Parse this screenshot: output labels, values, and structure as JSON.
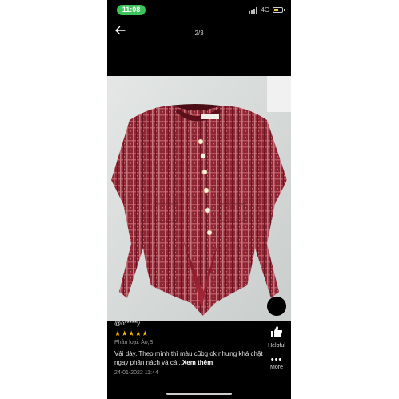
{
  "status_bar": {
    "time": "11:08",
    "network": "4G",
    "battery_level": 0.6
  },
  "viewer": {
    "page_counter": "2/3",
    "back_icon": "back-arrow-icon"
  },
  "review": {
    "reviewer": "@o*****y",
    "rating": 5,
    "stars": "★★★★★",
    "classification": "Phân loại: Áo,S",
    "text": "Vải dày. Theo mình thì màu cũbg ok nhưng khá chật ngay phần nách và cá...",
    "see_more": "Xem thêm",
    "date": "24-01-2022 11:44"
  },
  "actions": {
    "helpful_label": "Helpful",
    "more_label": "More"
  },
  "colors": {
    "status_pill": "#3cc35a",
    "star": "#f2b400",
    "jacket": "#8f2434"
  }
}
